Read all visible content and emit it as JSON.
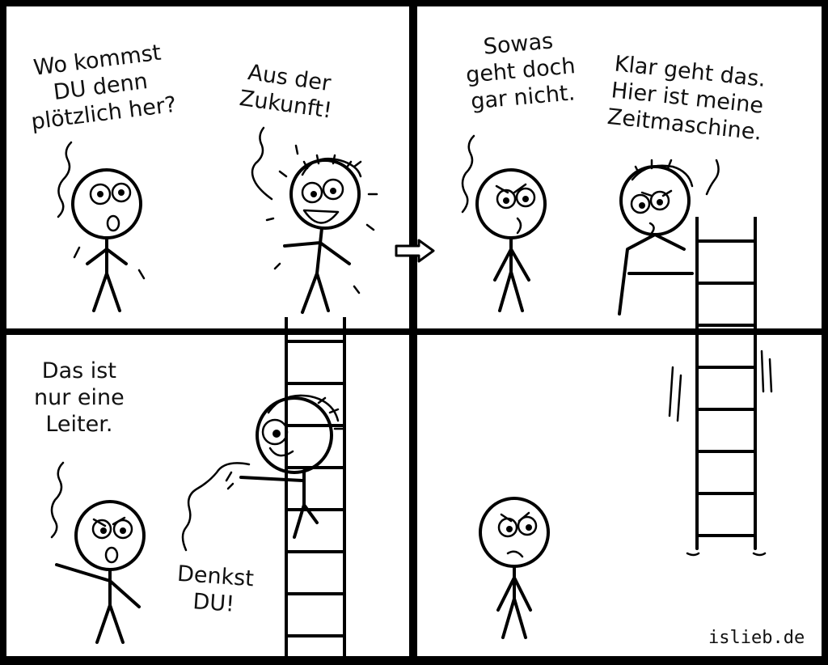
{
  "comic": {
    "panel1": {
      "left_speech": "Wo kommst\nDU denn\nplötzlich her?",
      "right_speech": "Aus der\nZukunft!"
    },
    "panel2": {
      "left_speech": "Sowas\ngeht doch\ngar nicht.",
      "right_speech": "Klar geht das.\nHier ist meine\nZeitmaschine."
    },
    "panel3": {
      "left_speech": "Das ist\nnur eine\nLeiter.",
      "right_speech": "Denkst\nDU!"
    },
    "panel4": {
      "signature": "islieb.de"
    }
  }
}
